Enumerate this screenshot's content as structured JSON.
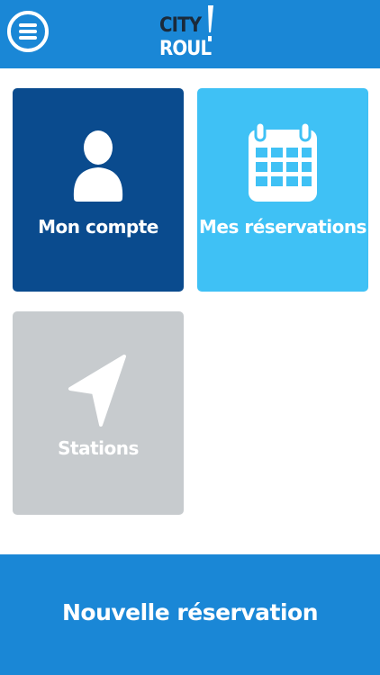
{
  "header": {
    "logo_line1": "CITY",
    "logo_line2": "ROUL",
    "menu_icon": "hamburger-menu-icon",
    "colors": {
      "bar": "#1a87d6",
      "logo_dark": "#1b2a3a"
    }
  },
  "tiles": [
    {
      "label": "Mon compte",
      "icon": "user-icon",
      "color": "#0a4b8e"
    },
    {
      "label": "Mes réservations",
      "icon": "calendar-icon",
      "color": "#3fc1f5"
    },
    {
      "label": "Stations",
      "icon": "navigation-arrow-icon",
      "color": "#c7cbce"
    }
  ],
  "bottom_bar": {
    "label": "Nouvelle réservation",
    "color": "#1a87d6"
  }
}
